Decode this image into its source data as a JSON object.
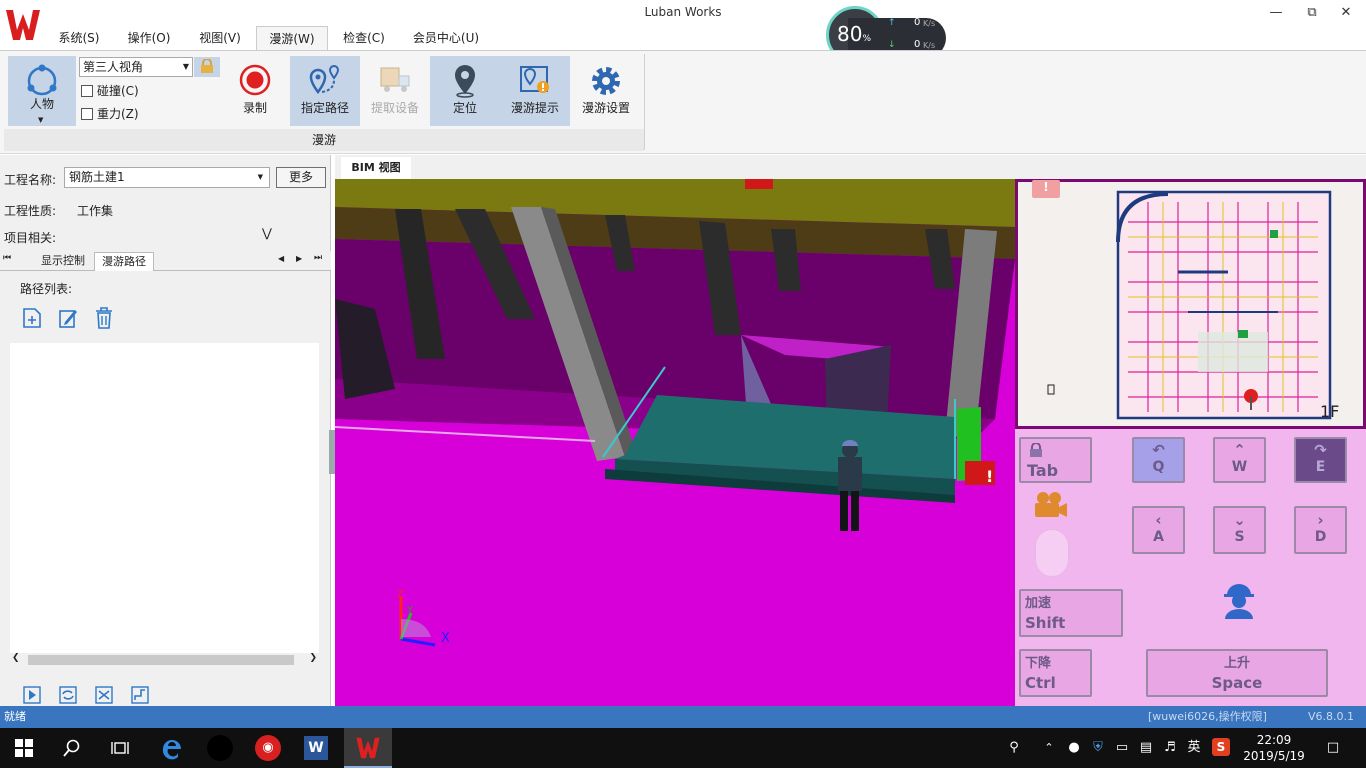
{
  "app": {
    "title": "Luban Works",
    "version": "V6.8.0.1",
    "user_info": "[wuwei6026,操作权限]",
    "status": "就绪"
  },
  "colors": {
    "accent_blue": "#3a76c0",
    "ribbon_selected": "#c5d4e6",
    "floor_magenta": "#d800d8",
    "deck_teal": "#1f6e6e",
    "record_red": "#e02020"
  },
  "speed_widget": {
    "percent": "80",
    "percent_unit": "%",
    "upload": "0",
    "download": "0",
    "unit": "K/s"
  },
  "menu": {
    "tabs": [
      "系统(S)",
      "操作(O)",
      "视图(V)",
      "漫游(W)",
      "检查(C)",
      "会员中心(U)"
    ],
    "active_index": 3
  },
  "ribbon": {
    "character_label": "人物",
    "view_mode": "第三人视角",
    "collision_label": "碰撞(C)",
    "gravity_label": "重力(Z)",
    "record_label": "录制",
    "path_label": "指定路径",
    "extract_label": "提取设备",
    "locate_label": "定位",
    "tips_label": "漫游提示",
    "settings_label": "漫游设置",
    "group_label": "漫游"
  },
  "left_panel": {
    "project_name_label": "工程名称:",
    "project_name_value": "钢筋土建1",
    "more_button": "更多",
    "project_type_label": "工程性质:",
    "project_type_value": "工作集",
    "project_related_label": "项目相关:",
    "tabs": [
      "显示控制",
      "漫游路径"
    ],
    "active_tab": 1,
    "path_list_label": "路径列表:"
  },
  "viewport": {
    "tab_label": "BIM 视图",
    "axis_x": "X",
    "axis_y": "Y",
    "axis_z": "Z",
    "floor_label": "1F"
  },
  "controls": {
    "tab_key": "Tab",
    "q_key": "Q",
    "w_key": "W",
    "e_key": "E",
    "a_key": "A",
    "s_key": "S",
    "d_key": "D",
    "accelerate_label": "加速",
    "shift_key": "Shift",
    "down_label": "下降",
    "ctrl_key": "Ctrl",
    "up_label": "上升",
    "space_key": "Space"
  },
  "taskbar": {
    "time": "22:09",
    "date": "2019/5/19",
    "ime": "英"
  }
}
